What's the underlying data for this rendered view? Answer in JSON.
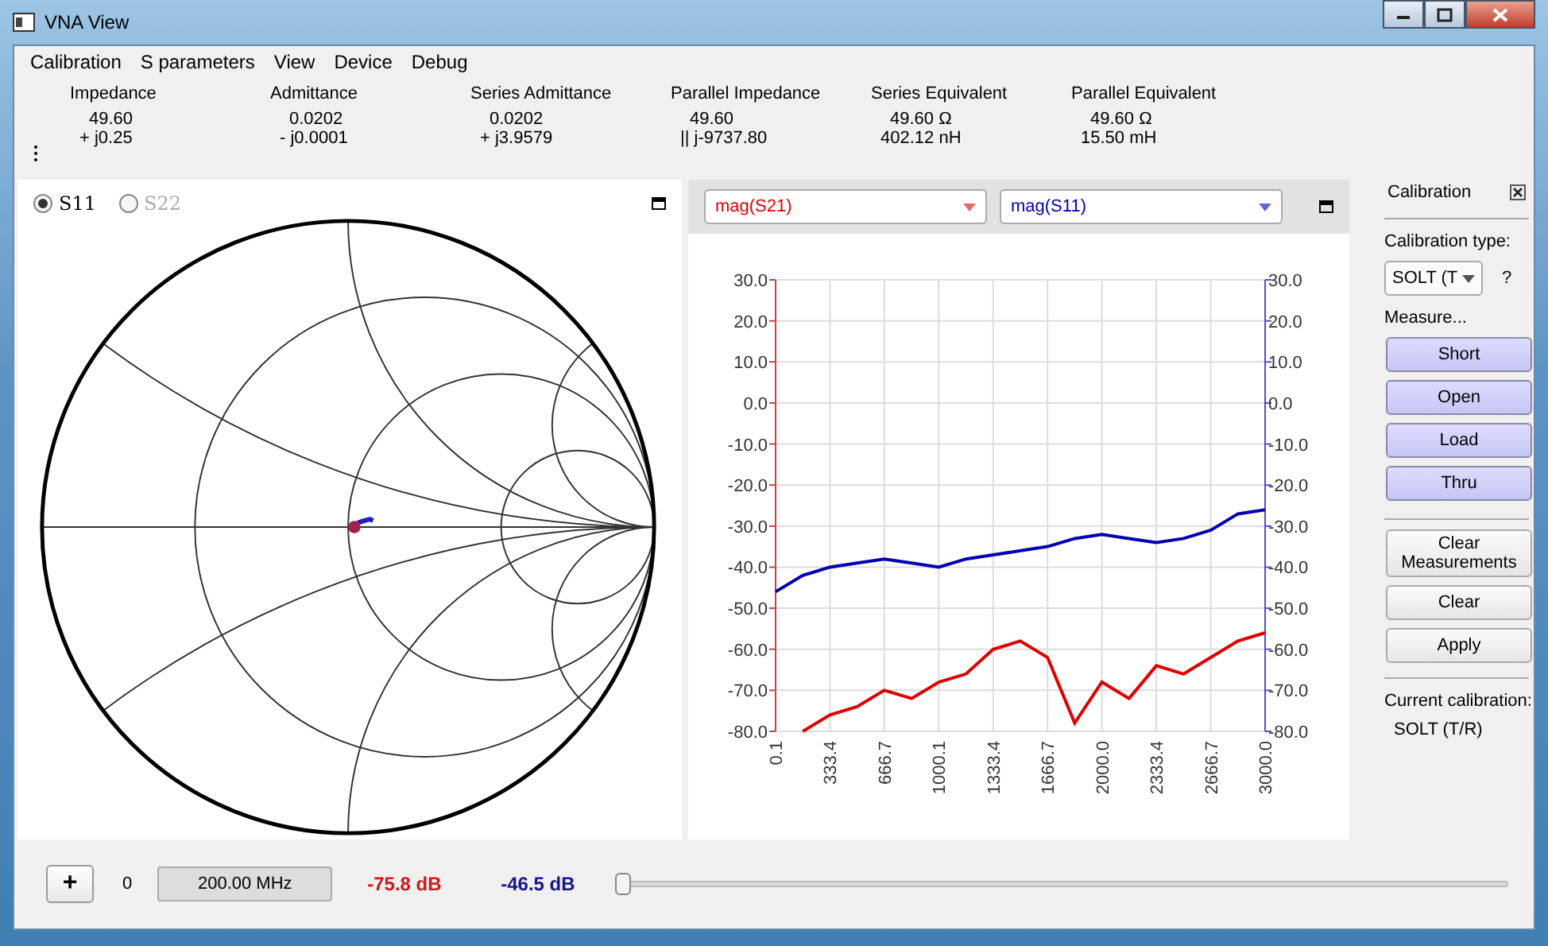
{
  "window": {
    "title": "VNA View"
  },
  "menu": [
    "Calibration",
    "S parameters",
    "View",
    "Device",
    "Debug"
  ],
  "measurements": [
    {
      "label": "Impedance",
      "value": "49.60",
      "value2": "+ j0.25"
    },
    {
      "label": "Admittance",
      "value": "0.0202",
      "value2": "- j0.0001"
    },
    {
      "label": "Series Admittance",
      "value": "0.0202",
      "value2": "+ j3.9579"
    },
    {
      "label": "Parallel Impedance",
      "value": "49.60",
      "value2": "|| j-9737.80"
    },
    {
      "label": "Series Equivalent",
      "value": "49.60 Ω",
      "value2": "402.12 nH"
    },
    {
      "label": "Parallel Equivalent",
      "value": "49.60 Ω",
      "value2": "15.50 mH"
    }
  ],
  "smith": {
    "radios": [
      {
        "label": "S11",
        "selected": true,
        "disabled": false
      },
      {
        "label": "S22",
        "selected": false,
        "disabled": true
      }
    ]
  },
  "plot": {
    "right_axis_ticks": [
      "30.0",
      "20.0",
      "10.0",
      "0.0",
      "-10.0",
      "-20.0",
      "-30.0",
      "-40.0",
      "-50.0",
      "-60.0",
      "-70.0",
      "-80.0"
    ],
    "chart_data": {
      "type": "line",
      "x": [
        0.1,
        166.7,
        333.4,
        500,
        666.7,
        833.4,
        1000.1,
        1166.7,
        1333.4,
        1500,
        1666.7,
        1833.4,
        2000,
        2166.7,
        2333.4,
        2500,
        2666.7,
        2833.4,
        3000
      ],
      "series": [
        {
          "name": "mag(S21)",
          "color": "#e00000",
          "values": [
            null,
            -80,
            -76,
            -74,
            -70,
            -72,
            -68,
            -66,
            -60,
            -58,
            -62,
            -78,
            -68,
            -72,
            -64,
            -66,
            -62,
            -58,
            -56
          ]
        },
        {
          "name": "mag(S11)",
          "color": "#0000b0",
          "values": [
            -46,
            -42,
            -40,
            -39,
            -38,
            -39,
            -40,
            -38,
            -37,
            -36,
            -35,
            -33,
            -32,
            -33,
            -34,
            -33,
            -31,
            -27,
            -26
          ]
        }
      ],
      "xlim": [
        0.1,
        3000
      ],
      "ylim": [
        -80,
        30
      ],
      "grid": true,
      "xticks": [
        {
          "value": 0.1,
          "label": "0.1"
        },
        {
          "value": 333.4,
          "label": "333.4"
        },
        {
          "value": 666.7,
          "label": "666.7"
        },
        {
          "value": 1000.1,
          "label": "1000.1"
        },
        {
          "value": 1333.4,
          "label": "1333.4"
        },
        {
          "value": 1666.7,
          "label": "1666.7"
        },
        {
          "value": 2000,
          "label": "2000.0"
        },
        {
          "value": 2333.4,
          "label": "2333.4"
        },
        {
          "value": 2666.7,
          "label": "2666.7"
        },
        {
          "value": 3000,
          "label": "3000.0"
        }
      ],
      "yticks": [
        {
          "value": 30,
          "label": "30.0"
        },
        {
          "value": 20,
          "label": "20.0"
        },
        {
          "value": 10,
          "label": "10.0"
        },
        {
          "value": 0,
          "label": "0.0"
        },
        {
          "value": -10,
          "label": "-10.0"
        },
        {
          "value": -20,
          "label": "-20.0"
        },
        {
          "value": -30,
          "label": "-30.0"
        },
        {
          "value": -40,
          "label": "-40.0"
        },
        {
          "value": -50,
          "label": "-50.0"
        },
        {
          "value": -60,
          "label": "-60.0"
        },
        {
          "value": -70,
          "label": "-70.0"
        },
        {
          "value": -80,
          "label": "-80.0"
        }
      ]
    }
  },
  "calibration": {
    "title": "Calibration",
    "type_label": "Calibration type:",
    "type_value": "SOLT (T",
    "help": "?",
    "measure_label": "Measure...",
    "buttons": [
      {
        "label": "Short",
        "kind": "measure"
      },
      {
        "label": "Open",
        "kind": "measure"
      },
      {
        "label": "Load",
        "kind": "measure"
      },
      {
        "label": "Thru",
        "kind": "measure"
      },
      {
        "label": "Clear Measurements",
        "kind": "plain"
      },
      {
        "label": "Clear",
        "kind": "plain"
      },
      {
        "label": "Apply",
        "kind": "plain"
      }
    ],
    "current_label": "Current calibration:",
    "current_value": "SOLT (T/R)"
  },
  "bottom_bar": {
    "add": "+",
    "index": "0",
    "frequency": "200.00 MHz",
    "readouts": [
      {
        "text": "-75.8 dB",
        "color": "#cc1a1a"
      },
      {
        "text": "-46.5 dB",
        "color": "#16168c"
      }
    ],
    "slider": {
      "level": 0
    }
  }
}
